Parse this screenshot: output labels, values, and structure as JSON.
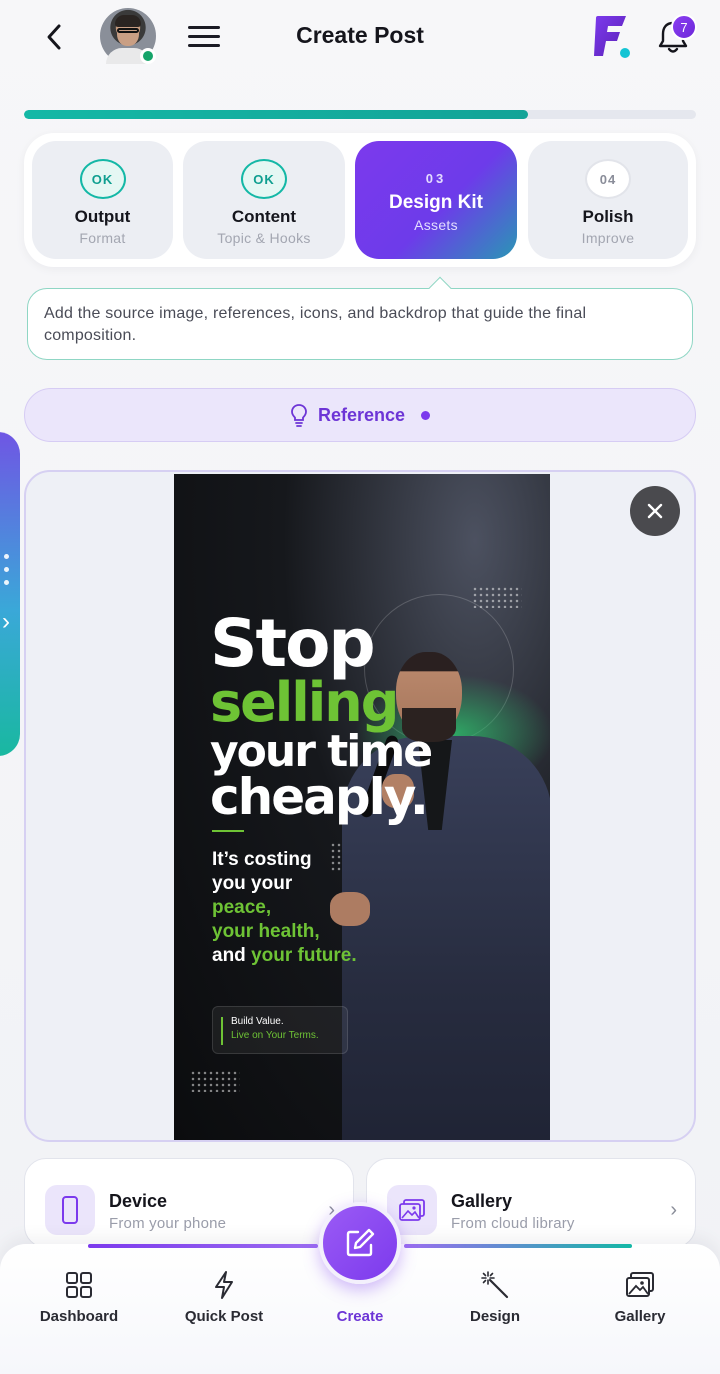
{
  "header": {
    "title": "Create Post",
    "notification_count": "7"
  },
  "progress": {
    "value": 0.75,
    "color": "#14b8a6"
  },
  "steps": [
    {
      "badge": "OK",
      "title": "Output",
      "subtitle": "Format",
      "state": "done"
    },
    {
      "badge": "OK",
      "title": "Content",
      "subtitle": "Topic & Hooks",
      "state": "done"
    },
    {
      "badge": "03",
      "title": "Design Kit",
      "subtitle": "Assets",
      "state": "active"
    },
    {
      "badge": "04",
      "title": "Polish",
      "subtitle": "Improve",
      "state": "pending"
    }
  ],
  "info": {
    "text": "Add the source image, references, icons, and backdrop that guide the final composition."
  },
  "reference": {
    "label": "Reference",
    "icon": "lightbulb-icon"
  },
  "preview": {
    "poster": {
      "line1": "Stop",
      "line2": "selling",
      "line3": "your time",
      "line4": "cheaply.",
      "body1": "It’s costing",
      "body2": "you your",
      "body3": "peace,",
      "body4": "your health,",
      "body5_prefix": "and",
      "body5_accent": "your future.",
      "cta1": "Build Value.",
      "cta2": "Live on Your Terms."
    },
    "close_icon": "close-icon"
  },
  "sources": [
    {
      "title": "Device",
      "subtitle": "From your phone",
      "icon": "phone-icon"
    },
    {
      "title": "Gallery",
      "subtitle": "From cloud library",
      "icon": "image-icon"
    }
  ],
  "nav": [
    {
      "label": "Dashboard",
      "icon": "grid-icon"
    },
    {
      "label": "Quick Post",
      "icon": "lightning-icon"
    },
    {
      "label": "Create",
      "icon": "edit-icon",
      "active": true
    },
    {
      "label": "Design",
      "icon": "magic-wand-icon"
    },
    {
      "label": "Gallery",
      "icon": "gallery-icon"
    }
  ],
  "colors": {
    "brand_purple": "#7c3aed",
    "teal": "#14b8a6",
    "accent_green": "#6ec335"
  }
}
